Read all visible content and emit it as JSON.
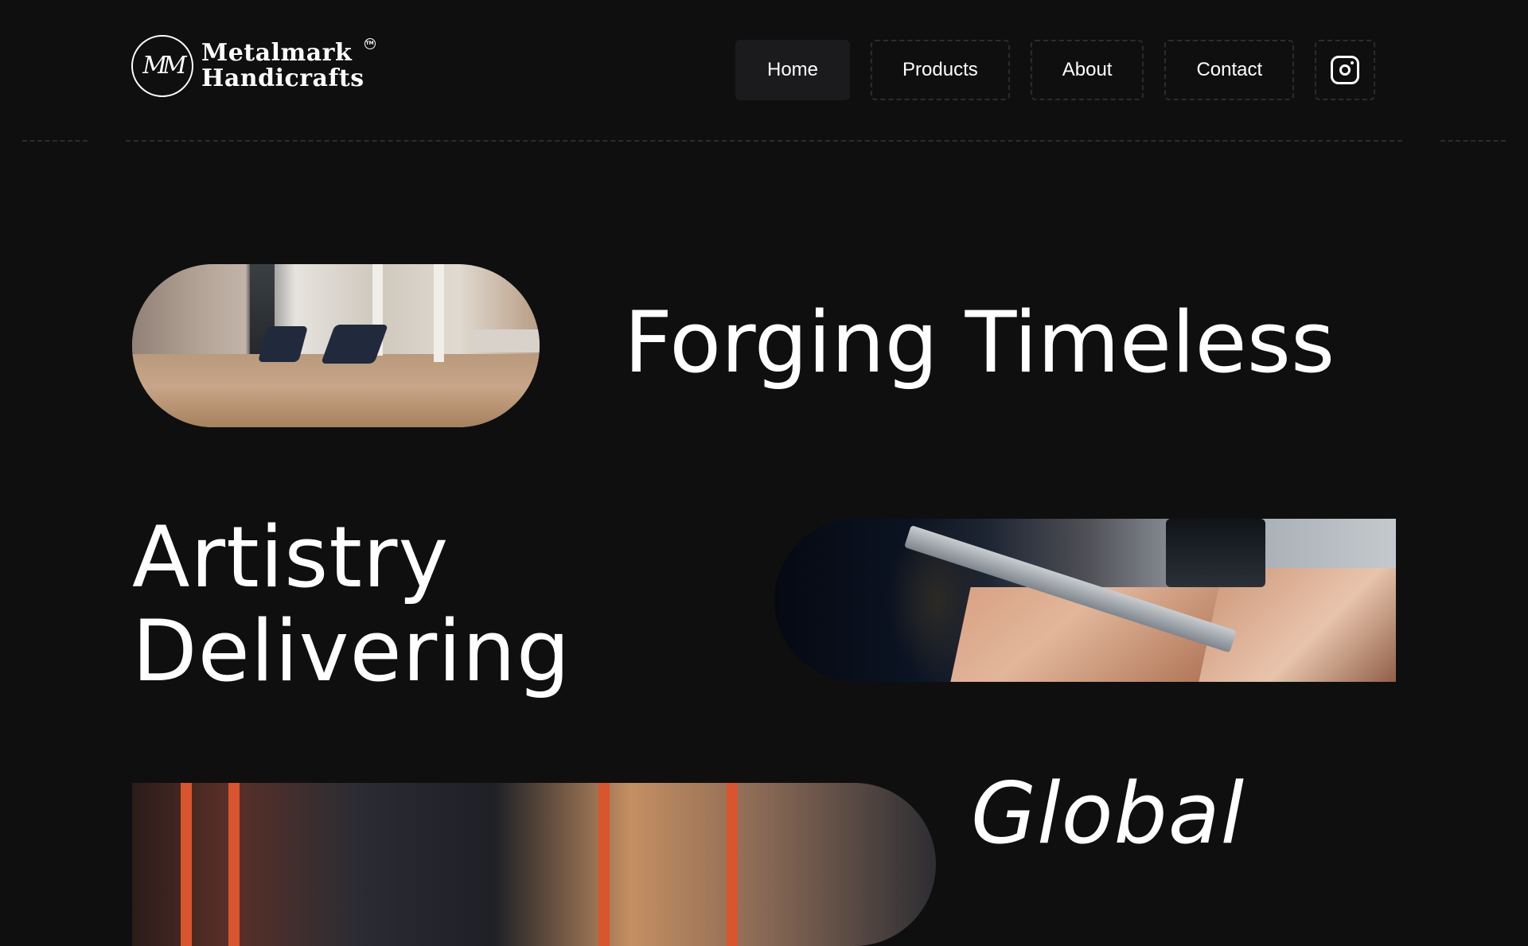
{
  "brand": {
    "monogram": "MM",
    "name_line1": "Metalmark",
    "name_line2": "Handicrafts",
    "trademark": "TM"
  },
  "nav": {
    "items": [
      {
        "label": "Home",
        "active": true
      },
      {
        "label": "Products",
        "active": false
      },
      {
        "label": "About",
        "active": false
      },
      {
        "label": "Contact",
        "active": false
      }
    ],
    "social_icon": "instagram-icon"
  },
  "hero": {
    "line1": "Forging Timeless",
    "line2": "Artistry",
    "line3": "Delivering",
    "line4": "Global",
    "images": [
      "living-room-photo",
      "woodworking-saw-photo",
      "workshop-photo"
    ]
  },
  "colors": {
    "background": "#0f0f10",
    "text": "#ffffff",
    "nav_active_bg": "#1b1b1d",
    "dashed_border": "#2c2c2e"
  }
}
